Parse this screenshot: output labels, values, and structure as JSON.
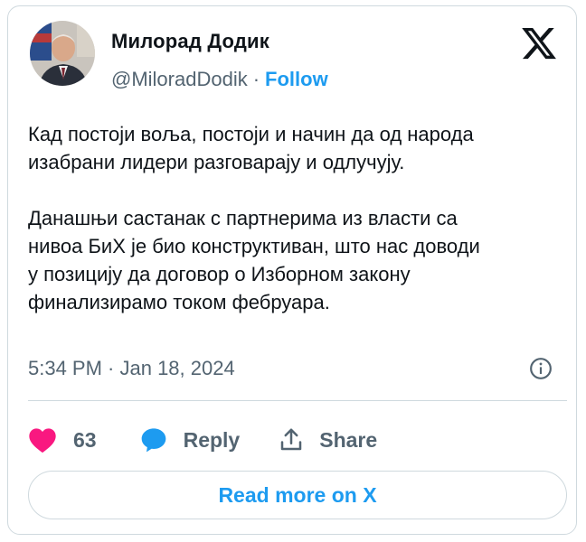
{
  "tweet": {
    "author": {
      "name": "Милорад Додик",
      "handle": "@MiloradDodik",
      "separator": "·",
      "follow_label": "Follow",
      "avatar_icon": "profile-photo"
    },
    "brand_icon": "x-logo-icon",
    "text_paragraphs": [
      [
        "Кад постоји воља, постоји и начин да од народа",
        "изабрани лидери разговарају и одлучују."
      ],
      [
        "Данашњи састанак с партнерима из власти са",
        "нивоа БиХ је био конструктиван, што нас доводи",
        "у позицију да договор о Изборном закону",
        "финализирамо током фебруара."
      ]
    ],
    "timestamp": "5:34 PM · Jan 18, 2024",
    "actions": {
      "like_count": "63",
      "reply_label": "Reply",
      "share_label": "Share"
    },
    "read_more_label": "Read more on X",
    "colors": {
      "accent": "#1d9bf0",
      "like": "#f91880",
      "text": "#0f1419",
      "secondary": "#536471",
      "border": "#cfd9de"
    }
  }
}
